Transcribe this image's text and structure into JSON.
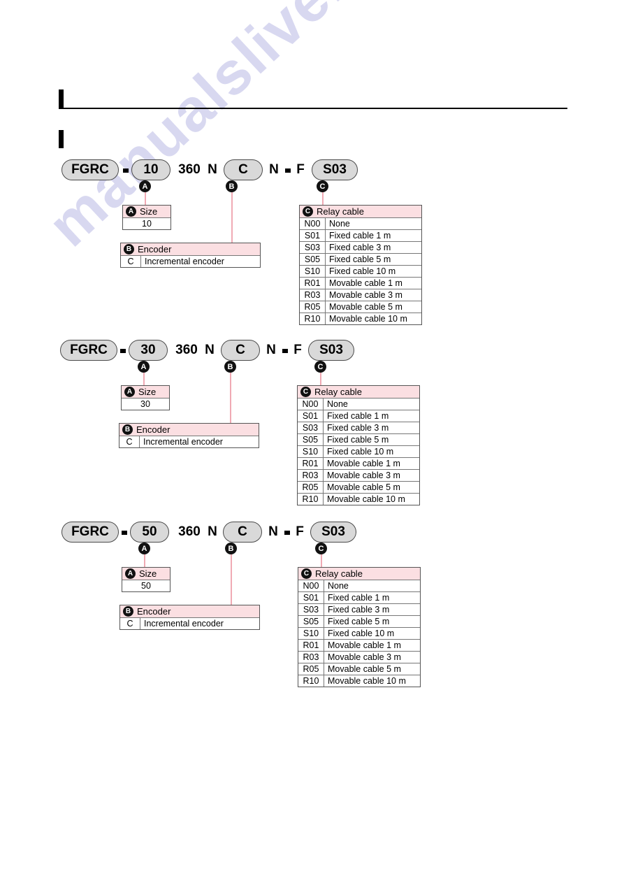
{
  "watermark": {
    "text": "manualslive.com"
  },
  "blocks": [
    {
      "id": "block-10",
      "model": {
        "prefix": "FGRC",
        "separator1": "-",
        "size": "10",
        "pulses": "360",
        "n1": "N",
        "encoder": "C",
        "n2": "N",
        "separator2": "-",
        "f": "F",
        "relay": "S03"
      },
      "markers": {
        "a": "A",
        "b": "B",
        "c": "C"
      },
      "size_table": {
        "badge": "A",
        "title": "Size",
        "values": [
          "10"
        ]
      },
      "encoder_table": {
        "badge": "B",
        "title": "Encoder",
        "rows": [
          {
            "code": "C",
            "desc": "Incremental encoder"
          }
        ]
      },
      "relay_table": {
        "badge": "C",
        "title": "Relay cable",
        "rows": [
          {
            "code": "N00",
            "desc": "None"
          },
          {
            "code": "S01",
            "desc": "Fixed cable  1 m"
          },
          {
            "code": "S03",
            "desc": "Fixed cable  3 m"
          },
          {
            "code": "S05",
            "desc": "Fixed cable  5 m"
          },
          {
            "code": "S10",
            "desc": "Fixed cable  10 m"
          },
          {
            "code": "R01",
            "desc": "Movable cable 1 m"
          },
          {
            "code": "R03",
            "desc": "Movable cable 3 m"
          },
          {
            "code": "R05",
            "desc": "Movable cable 5 m"
          },
          {
            "code": "R10",
            "desc": "Movable cable 10 m"
          }
        ]
      }
    },
    {
      "id": "block-30",
      "model": {
        "prefix": "FGRC",
        "separator1": "-",
        "size": "30",
        "pulses": "360",
        "n1": "N",
        "encoder": "C",
        "n2": "N",
        "separator2": "-",
        "f": "F",
        "relay": "S03"
      },
      "markers": {
        "a": "A",
        "b": "B",
        "c": "C"
      },
      "size_table": {
        "badge": "A",
        "title": "Size",
        "values": [
          "30"
        ]
      },
      "encoder_table": {
        "badge": "B",
        "title": "Encoder",
        "rows": [
          {
            "code": "C",
            "desc": "Incremental encoder"
          }
        ]
      },
      "relay_table": {
        "badge": "C",
        "title": "Relay cable",
        "rows": [
          {
            "code": "N00",
            "desc": "None"
          },
          {
            "code": "S01",
            "desc": "Fixed cable  1 m"
          },
          {
            "code": "S03",
            "desc": "Fixed cable  3 m"
          },
          {
            "code": "S05",
            "desc": "Fixed cable  5 m"
          },
          {
            "code": "S10",
            "desc": "Fixed cable  10 m"
          },
          {
            "code": "R01",
            "desc": "Movable cable 1 m"
          },
          {
            "code": "R03",
            "desc": "Movable cable 3 m"
          },
          {
            "code": "R05",
            "desc": "Movable cable 5 m"
          },
          {
            "code": "R10",
            "desc": "Movable cable 10 m"
          }
        ]
      }
    },
    {
      "id": "block-50",
      "model": {
        "prefix": "FGRC",
        "separator1": "-",
        "size": "50",
        "pulses": "360",
        "n1": "N",
        "encoder": "C",
        "n2": "N",
        "separator2": "-",
        "f": "F",
        "relay": "S03"
      },
      "markers": {
        "a": "A",
        "b": "B",
        "c": "C"
      },
      "size_table": {
        "badge": "A",
        "title": "Size",
        "values": [
          "50"
        ]
      },
      "encoder_table": {
        "badge": "B",
        "title": "Encoder",
        "rows": [
          {
            "code": "C",
            "desc": "Incremental encoder"
          }
        ]
      },
      "relay_table": {
        "badge": "C",
        "title": "Relay cable",
        "rows": [
          {
            "code": "N00",
            "desc": "None"
          },
          {
            "code": "S01",
            "desc": "Fixed cable  1 m"
          },
          {
            "code": "S03",
            "desc": "Fixed cable  3 m"
          },
          {
            "code": "S05",
            "desc": "Fixed cable  5 m"
          },
          {
            "code": "S10",
            "desc": "Fixed cable  10 m"
          },
          {
            "code": "R01",
            "desc": "Movable cable 1 m"
          },
          {
            "code": "R03",
            "desc": "Movable cable 3 m"
          },
          {
            "code": "R05",
            "desc": "Movable cable 5 m"
          },
          {
            "code": "R10",
            "desc": "Movable cable 10 m"
          }
        ]
      }
    }
  ]
}
